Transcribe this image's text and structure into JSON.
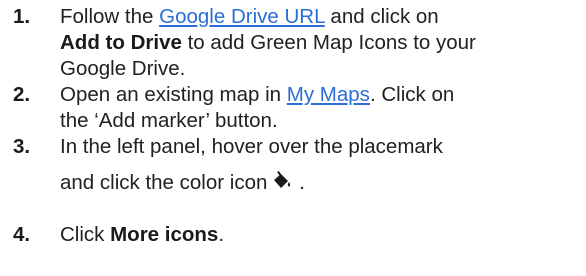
{
  "steps": [
    {
      "number": "1.",
      "line1_pre": "Follow the ",
      "link": "Google Drive URL",
      "line1_post": " and click on",
      "line2_bold": "Add to Drive",
      "line2_rest": " to add Green Map Icons to your",
      "line3": "Google Drive."
    },
    {
      "number": "2.",
      "line1_pre": "Open an existing map in ",
      "link": "My Maps",
      "line1_post": ".  Click on",
      "line2": "the ‘Add marker’ button."
    },
    {
      "number": "3.",
      "line1": "In the left panel, hover over the placemark",
      "line2": "and click the color icon",
      "line2_end": " ."
    },
    {
      "number": "4.",
      "text_pre": "Click ",
      "bold": "More icons",
      "text_post": "."
    }
  ],
  "colors": {
    "text": "#212121",
    "link": "#2b6fd6"
  },
  "icons": {
    "color_icon": "paint-bucket-icon"
  }
}
